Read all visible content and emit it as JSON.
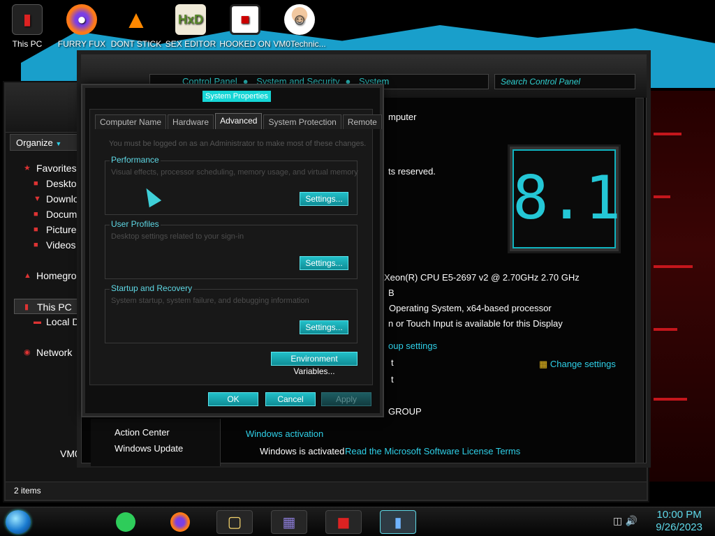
{
  "desktop": {
    "icons": [
      {
        "label": "This PC",
        "icon": "computer-icon"
      },
      {
        "label": "FURRY FUX",
        "icon": "firefox-icon"
      },
      {
        "label": "DONT STICK",
        "icon": "vlc-cone-icon"
      },
      {
        "label": "SEX EDITOR",
        "icon": "hxd-editor-icon"
      },
      {
        "label": "HOOKED ON",
        "icon": "game-icon"
      },
      {
        "label": "VM0Technic...",
        "icon": "doctor-avatar-icon"
      }
    ]
  },
  "explorer": {
    "organize_label": "Organize",
    "nav": {
      "favorites": "Favorites",
      "desktop": "Desktop",
      "downloads": "Downloads",
      "documents": "Documents",
      "pictures": "Pictures",
      "videos": "Videos",
      "homegroup": "Homegroup",
      "this_pc": "This PC",
      "local_disk": "Local Disk",
      "network": "Network"
    },
    "computer_name_partial": "VM0",
    "status_text": "2 items"
  },
  "control_panel": {
    "breadcrumb": [
      "Control Panel",
      "System and Security",
      "System"
    ],
    "search_placeholder": "Search Control Panel",
    "lines": {
      "computer": "mputer",
      "rights": "ts reserved.",
      "processor": ") Xeon(R) CPU E5-2697 v2 @ 2.70GHz   2.70 GHz",
      "ram": "B",
      "system_type": "Operating System, x64-based processor",
      "pen_touch": "n or Touch Input is available for this Display",
      "group_settings": "oup settings",
      "name1": "t",
      "name2": "t",
      "workgroup": "GROUP"
    },
    "change_settings": "Change settings",
    "windows_version": "8.1",
    "see_also": [
      "Action Center",
      "Windows Update"
    ],
    "activation_heading": "Windows activation",
    "activation_status": "Windows is activated",
    "license_link": "Read the Microsoft Software License Terms"
  },
  "dialog": {
    "title": "System Properties",
    "tabs": [
      "Computer Name",
      "Hardware",
      "Advanced",
      "System Protection",
      "Remote"
    ],
    "active_tab": "Advanced",
    "admin_note": "You must be logged on as an Administrator to make most of these changes.",
    "performance": {
      "title": "Performance",
      "desc": "Visual effects, processor scheduling, memory usage, and virtual memory",
      "button": "Settings..."
    },
    "user_profiles": {
      "title": "User Profiles",
      "desc": "Desktop settings related to your sign-in",
      "button": "Settings..."
    },
    "startup_recovery": {
      "title": "Startup and Recovery",
      "desc": "System startup, system failure, and debugging information",
      "button": "Settings..."
    },
    "env_button": "Environment Variables...",
    "ok": "OK",
    "cancel": "Cancel",
    "apply": "Apply"
  },
  "taskbar": {
    "time": "10:00 PM",
    "date": "9/26/2023"
  },
  "colors": {
    "accent_cyan": "#16d6d6",
    "link_cyan": "#2fd0e8",
    "wallpaper_red": "#c4161c",
    "wallpaper_blue": "#1aa8d6"
  }
}
